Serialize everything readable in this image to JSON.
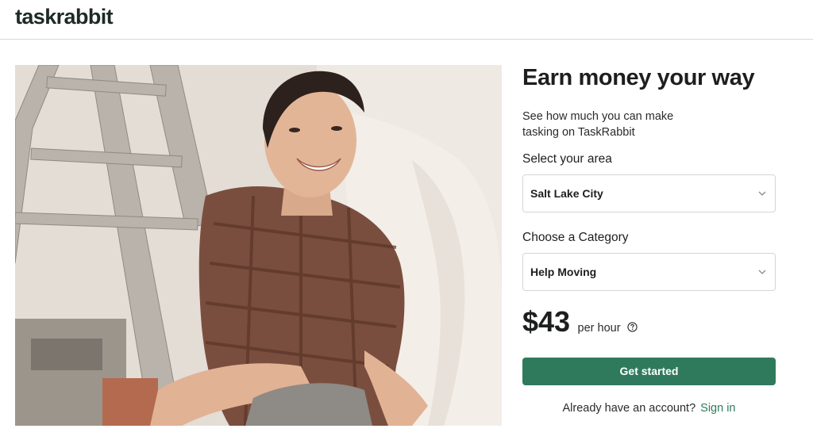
{
  "brand": {
    "logo_text": "taskrabbit"
  },
  "hero": {
    "image_description": ""
  },
  "panel": {
    "title": "Earn money your way",
    "subtitle": "See how much you can make tasking on TaskRabbit",
    "area": {
      "label": "Select your area",
      "value": "Salt Lake City"
    },
    "category": {
      "label": "Choose a Category",
      "value": "Help Moving"
    },
    "price": {
      "amount": "$43",
      "unit": "per hour"
    },
    "cta_label": "Get started",
    "signin": {
      "prompt": "Already have an account?",
      "link": "Sign in"
    }
  },
  "colors": {
    "brand_green": "#2f7a5c",
    "text": "#1d1f1e",
    "border": "#d5d5d5"
  },
  "icons": {
    "area_chevron": "chevron-down-icon",
    "category_chevron": "chevron-down-icon",
    "price_help": "help-circle-icon"
  }
}
